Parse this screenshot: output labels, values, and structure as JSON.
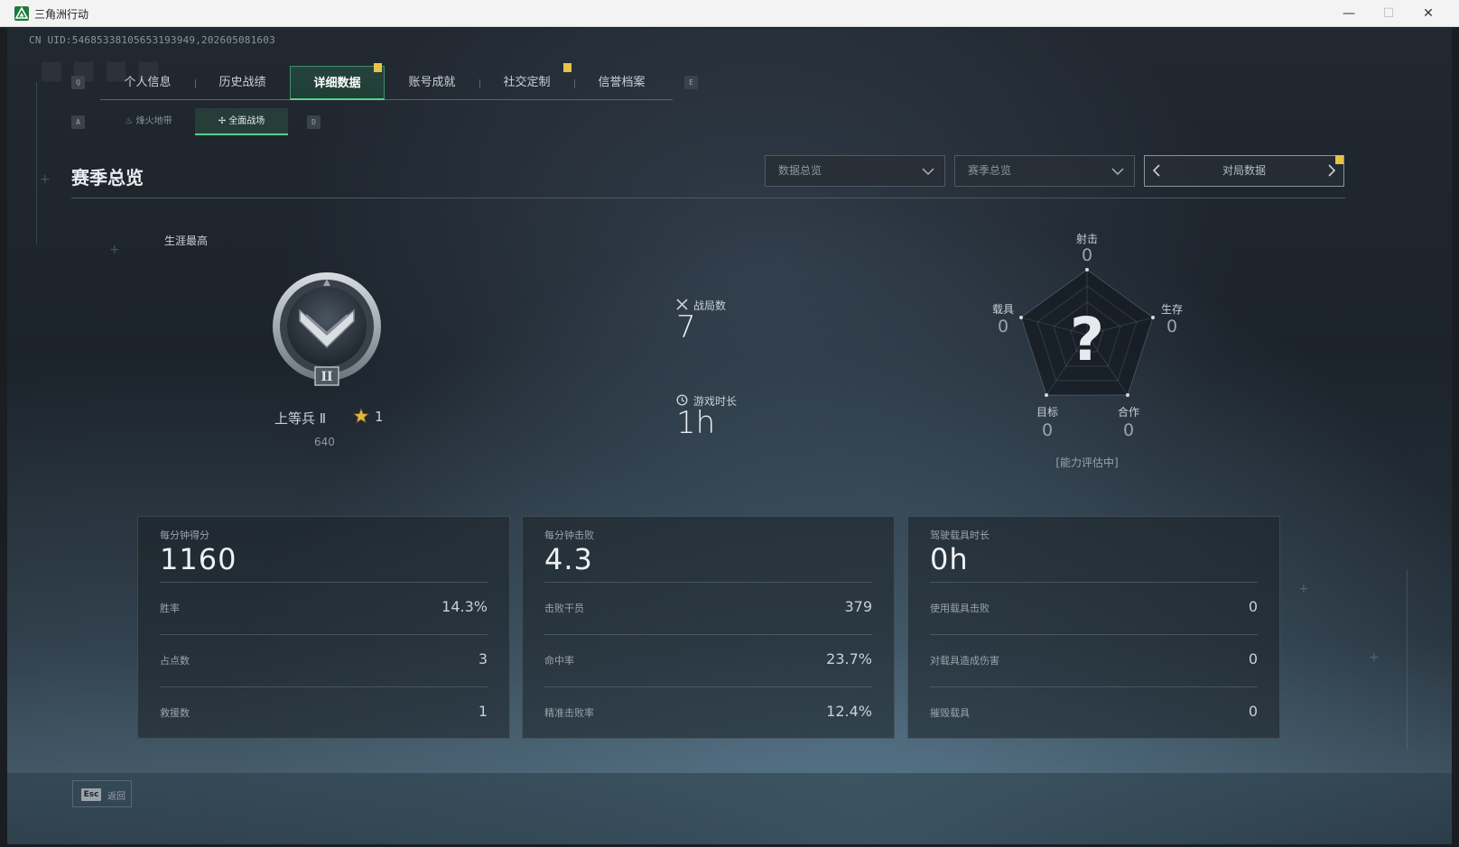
{
  "window": {
    "title": "三角洲行动",
    "minimize": "—",
    "maximize": "☐",
    "close": "✕"
  },
  "uid": "CN UID:5468533810565319394​9,202605081603",
  "main_tabs": {
    "key_left": "Q",
    "key_right": "E",
    "items": [
      {
        "label": "个人信息"
      },
      {
        "label": "历史战绩"
      },
      {
        "label": "详细数据"
      },
      {
        "label": "账号成就"
      },
      {
        "label": "社交定制"
      },
      {
        "label": "信誉档案"
      }
    ],
    "active_index": 2
  },
  "sub_tabs": {
    "key_left": "A",
    "key_right": "D",
    "items": [
      {
        "label": "烽火地带"
      },
      {
        "label": "全面战场"
      }
    ],
    "active_index": 1
  },
  "section": {
    "title": "赛季总览",
    "dropdown1": "数据总览",
    "dropdown2": "赛季总览",
    "pager_label": "对局数据"
  },
  "rank": {
    "career_label": "生涯最高",
    "name": "上等兵 Ⅱ",
    "stars": "1",
    "points": "640",
    "badge_numeral": "II"
  },
  "mid_stats": {
    "matches_label": "战局数",
    "matches_value": "7",
    "playtime_label": "游戏时长",
    "playtime_value": "1h"
  },
  "radar": {
    "center_mark": "?",
    "status": "[能力评估中]",
    "axes": [
      {
        "label": "射击",
        "value": "0"
      },
      {
        "label": "生存",
        "value": "0"
      },
      {
        "label": "合作",
        "value": "0"
      },
      {
        "label": "目标",
        "value": "0"
      },
      {
        "label": "载具",
        "value": "0"
      }
    ]
  },
  "cards": [
    {
      "head_label": "每分钟得分",
      "head_value": "1160",
      "rows": [
        {
          "label": "胜率",
          "value": "14.3%"
        },
        {
          "label": "占点数",
          "value": "3"
        },
        {
          "label": "救援数",
          "value": "1"
        }
      ]
    },
    {
      "head_label": "每分钟击败",
      "head_value": "4.3",
      "rows": [
        {
          "label": "击败干员",
          "value": "379"
        },
        {
          "label": "命中率",
          "value": "23.7%"
        },
        {
          "label": "精准击败率",
          "value": "12.4%"
        }
      ]
    },
    {
      "head_label": "驾驶载具时长",
      "head_value": "0h",
      "rows": [
        {
          "label": "使用载具击败",
          "value": "0"
        },
        {
          "label": "对载具造成伤害",
          "value": "0"
        },
        {
          "label": "摧毁载具",
          "value": "0"
        }
      ]
    }
  ],
  "footer": {
    "esc_key": "Esc",
    "esc_label": "返回"
  },
  "colors": {
    "accent_green": "#58d08c",
    "notif_yellow": "#e7c24a",
    "star_gold": "#e3b845"
  }
}
